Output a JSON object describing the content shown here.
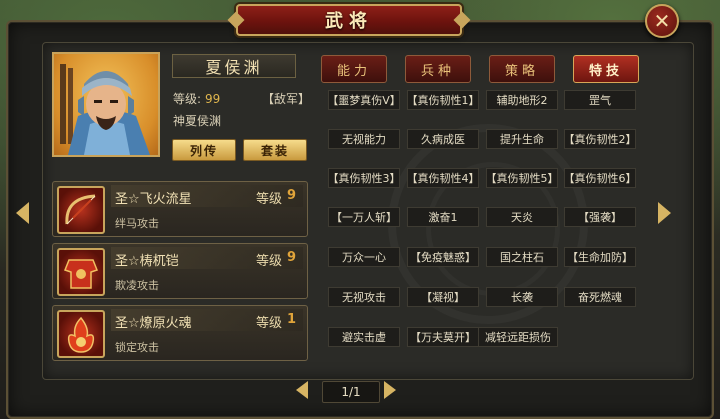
{
  "window": {
    "title": "武将"
  },
  "general": {
    "name": "夏侯渊",
    "level_label": "等级:",
    "level_value": "99",
    "faction": "【敌军】",
    "subtitle": "神夏侯渊",
    "biography_button": "列传",
    "equipment_button": "套装"
  },
  "equipment": [
    {
      "name": "圣☆飞火流星",
      "level_label": "等级",
      "level": "9",
      "effect": "绊马攻击"
    },
    {
      "name": "圣☆梼杌铠",
      "level_label": "等级",
      "level": "9",
      "effect": "欺凌攻击"
    },
    {
      "name": "圣☆燎原火魂",
      "level_label": "等级",
      "level": "1",
      "effect": "锁定攻击"
    }
  ],
  "tabs": [
    {
      "label": "能力"
    },
    {
      "label": "兵种"
    },
    {
      "label": "策略"
    },
    {
      "label": "特技",
      "active": true
    }
  ],
  "skills": [
    [
      "【噩梦真伤Ⅴ】",
      "【真伤韧性1】",
      "辅助地形2",
      "罡气"
    ],
    [
      "无视能力",
      "久病成医",
      "提升生命",
      "【真伤韧性2】"
    ],
    [
      "【真伤韧性3】",
      "【真伤韧性4】",
      "【真伤韧性5】",
      "【真伤韧性6】"
    ],
    [
      "【一万人斩】",
      "激奋1",
      "天炎",
      "【强袭】"
    ],
    [
      "万众一心",
      "【免疫魅惑】",
      "国之柱石",
      "【生命加防】"
    ],
    [
      "无视攻击",
      "【凝视】",
      "长袭",
      "奋死燃魂"
    ],
    [
      "避实击虚",
      "【万夫莫开】",
      "减轻远距损伤",
      ""
    ]
  ],
  "pager": {
    "text": "1/1"
  },
  "colors": {
    "accent": "#c8a55c",
    "tab_active": "#b13022",
    "level_value": "#e0a43a"
  }
}
